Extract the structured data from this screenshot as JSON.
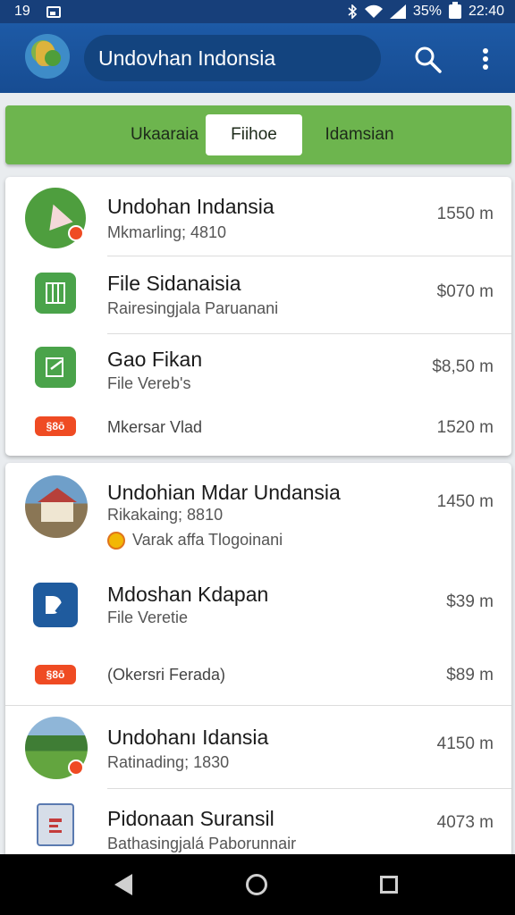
{
  "status_bar": {
    "left_number": "19",
    "battery_pct": "35%",
    "time": "22:40"
  },
  "app_bar": {
    "title": "Undovhan Indonsia"
  },
  "tabs": [
    {
      "label": "Ukaaraia",
      "active": false
    },
    {
      "label": "Fiihoe",
      "active": true
    },
    {
      "label": "Idamsian",
      "active": false
    }
  ],
  "card1": {
    "rows": [
      {
        "title": "Undohan Indansia",
        "subtitle": "Mkmarling; 4810",
        "distance": "1550 m"
      },
      {
        "title": "File Sidanaisia",
        "subtitle": "Rairesingjala Paruanani",
        "distance": "$070 m"
      },
      {
        "title": "Gao Fikan",
        "subtitle": "File Vereb's",
        "distance": "$8,50 m"
      },
      {
        "text": "Mkersar Vlad",
        "badge": "§8ō",
        "distance": "1520 m"
      }
    ]
  },
  "card2": {
    "rows": [
      {
        "title": "Undohian Mdar Undansia",
        "subtitle": "Rikakaing; 8810",
        "extra": "Varak affa Tlogoinani",
        "distance": "1450 m"
      },
      {
        "title": "Mdoshan Kdapan",
        "subtitle": "File Veretie",
        "distance": "$39 m"
      },
      {
        "text": "(Okersri Ferada)",
        "badge": "§8ō",
        "distance": "$89 m"
      },
      {
        "title": "Undohanı Idansia",
        "subtitle": "Ratinading; 1830",
        "distance": "4150 m"
      },
      {
        "title": "Pidonaan Suransil",
        "subtitle": "Bathasingjalá Paborunnair",
        "distance": "4073 m"
      }
    ]
  },
  "colors": {
    "app_bar": "#1d5aa6",
    "tab_strip": "#6db54e",
    "badge": "#ef4b23"
  },
  "icons": [
    "search-icon",
    "more-vert-icon",
    "back-nav-icon",
    "home-nav-icon",
    "recents-nav-icon"
  ]
}
